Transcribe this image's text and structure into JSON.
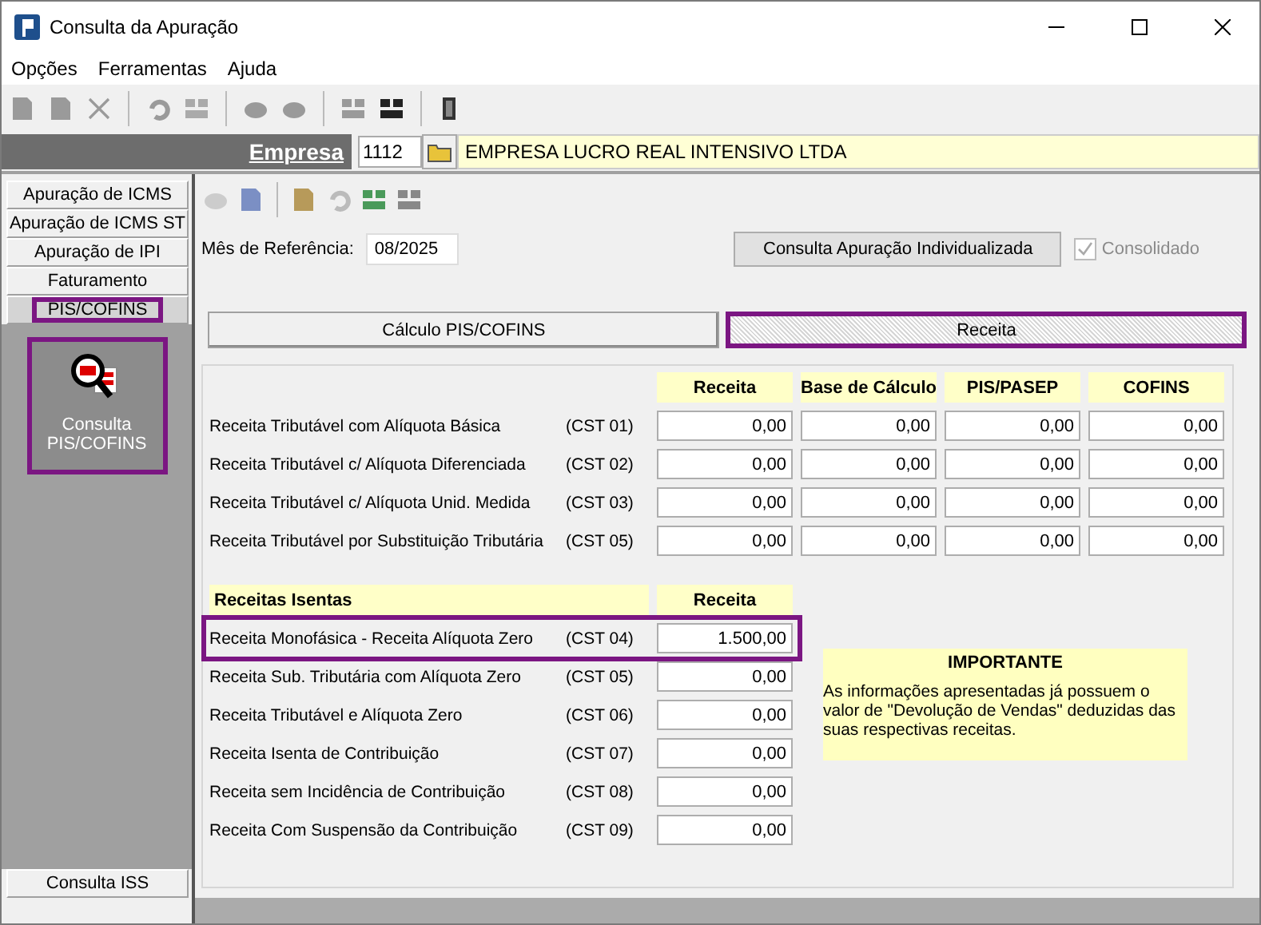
{
  "window": {
    "title": "Consulta da Apuração"
  },
  "menu": [
    "Opções",
    "Ferramentas",
    "Ajuda"
  ],
  "company": {
    "label": "Empresa",
    "code": "1112",
    "name": "EMPRESA LUCRO REAL INTENSIVO LTDA"
  },
  "sidebar": {
    "items": [
      {
        "label": "Apuração de ICMS",
        "selected": false,
        "highlighted": false
      },
      {
        "label": "Apuração de ICMS ST",
        "selected": false,
        "highlighted": false
      },
      {
        "label": "Apuração de IPI",
        "selected": false,
        "highlighted": false
      },
      {
        "label": "Faturamento",
        "selected": false,
        "highlighted": false
      },
      {
        "label": "PIS/COFINS",
        "selected": true,
        "highlighted": true
      }
    ],
    "module": {
      "label": "Consulta PIS/COFINS",
      "highlighted": true
    },
    "footer": "Consulta ISS"
  },
  "filters": {
    "month_label": "Mês de Referência:",
    "month": "08/2025",
    "button": "Consulta Apuração Individualizada",
    "consolidated": {
      "label": "Consolidado",
      "checked": true,
      "disabled": true
    }
  },
  "tabs": [
    {
      "label": "Cálculo PIS/COFINS",
      "selected": false,
      "highlighted": false
    },
    {
      "label": "Receita",
      "selected": true,
      "highlighted": true
    }
  ],
  "taxed": {
    "columns": [
      "Receita",
      "Base de Cálculo",
      "PIS/PASEP",
      "COFINS"
    ],
    "rows": [
      {
        "label": "Receita Tributável com Alíquota Básica",
        "code": "(CST 01)",
        "values": [
          "0,00",
          "0,00",
          "0,00",
          "0,00"
        ]
      },
      {
        "label": "Receita Tributável c/ Alíquota Diferenciada",
        "code": "(CST 02)",
        "values": [
          "0,00",
          "0,00",
          "0,00",
          "0,00"
        ]
      },
      {
        "label": "Receita Tributável c/ Alíquota Unid. Medida",
        "code": "(CST 03)",
        "values": [
          "0,00",
          "0,00",
          "0,00",
          "0,00"
        ]
      },
      {
        "label": "Receita Tributável por Substituição Tributária",
        "code": "(CST 05)",
        "values": [
          "0,00",
          "0,00",
          "0,00",
          "0,00"
        ]
      }
    ]
  },
  "exempt": {
    "title": "Receitas Isentas",
    "column": "Receita",
    "rows": [
      {
        "label": "Receita Monofásica - Receita Alíquota Zero",
        "code": "(CST 04)",
        "value": "1.500,00",
        "highlighted": true
      },
      {
        "label": "Receita Sub. Tributária com Alíquota Zero",
        "code": "(CST 05)",
        "value": "0,00",
        "highlighted": false
      },
      {
        "label": "Receita Tributável e Alíquota Zero",
        "code": "(CST 06)",
        "value": "0,00",
        "highlighted": false
      },
      {
        "label": "Receita Isenta de Contribuição",
        "code": "(CST 07)",
        "value": "0,00",
        "highlighted": false
      },
      {
        "label": "Receita sem Incidência de Contribuição",
        "code": "(CST 08)",
        "value": "0,00",
        "highlighted": false
      },
      {
        "label": "Receita Com Suspensão da Contribuição",
        "code": "(CST 09)",
        "value": "0,00",
        "highlighted": false
      }
    ]
  },
  "notice": {
    "title": "IMPORTANTE",
    "text": "As informações apresentadas já possuem o valor de \"Devolução de Vendas\" deduzidas das suas respectivas receitas."
  }
}
